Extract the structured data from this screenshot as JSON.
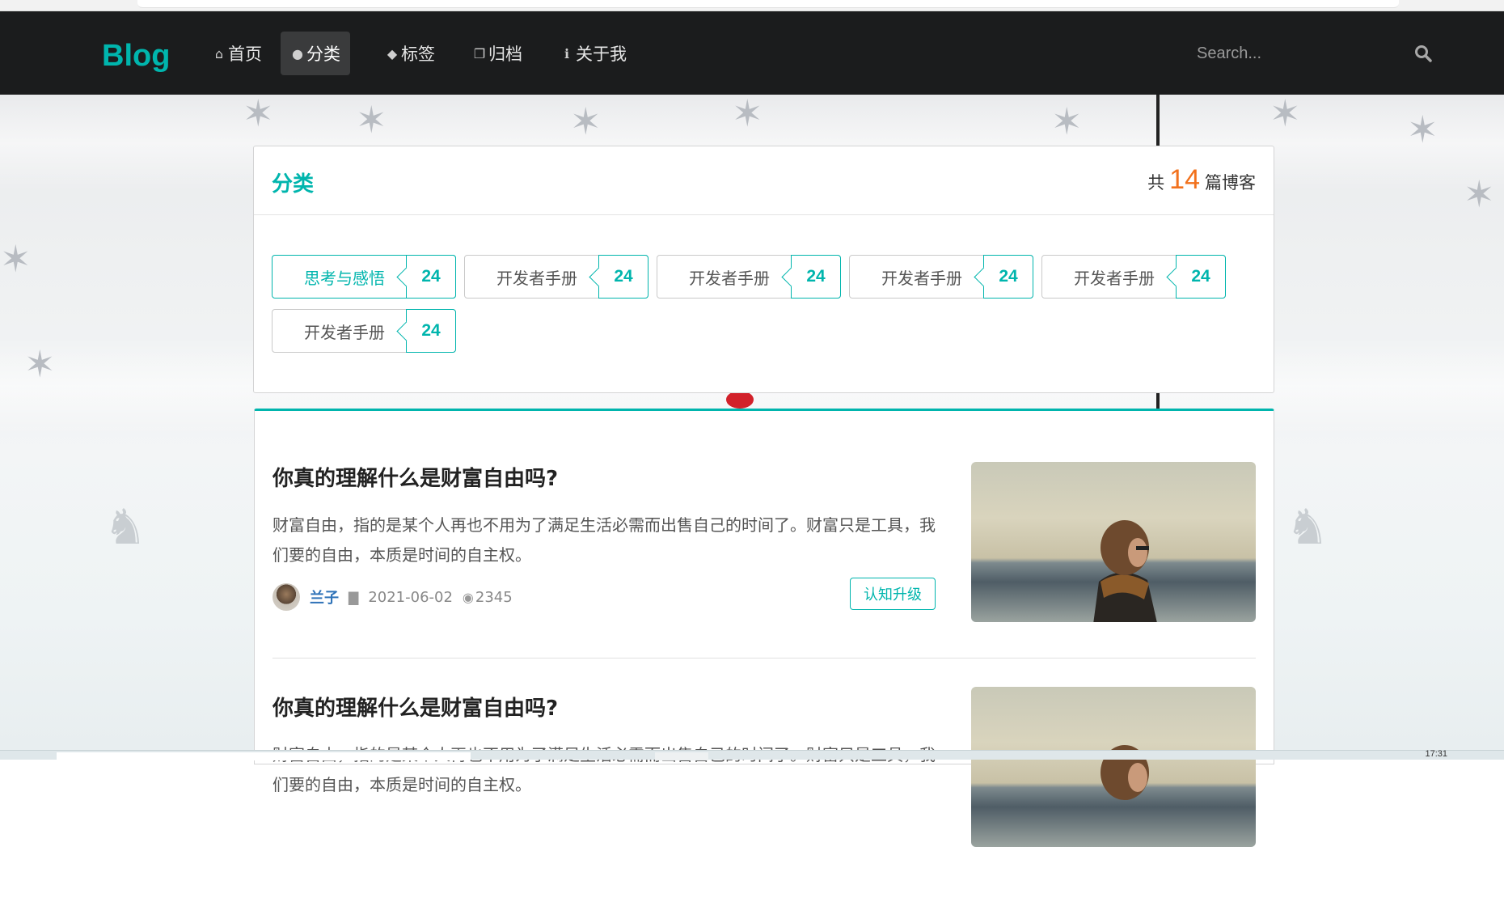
{
  "nav": {
    "brand": "Blog",
    "items": [
      {
        "label": "首页",
        "icon": "home-icon"
      },
      {
        "label": "分类",
        "icon": "lightbulb-icon"
      },
      {
        "label": "标签",
        "icon": "tags-icon"
      },
      {
        "label": "归档",
        "icon": "clone-icon"
      },
      {
        "label": "关于我",
        "icon": "info-icon"
      }
    ],
    "active_index": 1,
    "search_placeholder": "Search..."
  },
  "categories": {
    "title": "分类",
    "count_prefix": "共",
    "count": "14",
    "count_suffix": "篇博客",
    "tags": [
      {
        "label": "思考与感悟",
        "count": "24",
        "active": true
      },
      {
        "label": "开发者手册",
        "count": "24",
        "active": false
      },
      {
        "label": "开发者手册",
        "count": "24",
        "active": false
      },
      {
        "label": "开发者手册",
        "count": "24",
        "active": false
      },
      {
        "label": "开发者手册",
        "count": "24",
        "active": false
      },
      {
        "label": "开发者手册",
        "count": "24",
        "active": false
      }
    ]
  },
  "articles": [
    {
      "title": "你真的理解什么是财富自由吗?",
      "excerpt": "财富自由，指的是某个人再也不用为了满足生活必需而出售自己的时间了。财富只是工具，我们要的自由，本质是时间的自主权。",
      "author": "兰子",
      "date": "2021-06-02",
      "views": "2345",
      "category": "认知升级"
    },
    {
      "title": "你真的理解什么是财富自由吗?",
      "excerpt": "财富自由，指的是某个人再也不用为了满足生活必需而出售自己的时间了。财富只是工具，我们要的自由，本质是时间的自主权。"
    }
  ],
  "taskbar": {
    "clock": "17:31"
  },
  "colors": {
    "accent": "#00b5ad",
    "nav_bg": "#1b1c1d",
    "count_highlight": "#f2711c",
    "author": "#2f73b8"
  }
}
